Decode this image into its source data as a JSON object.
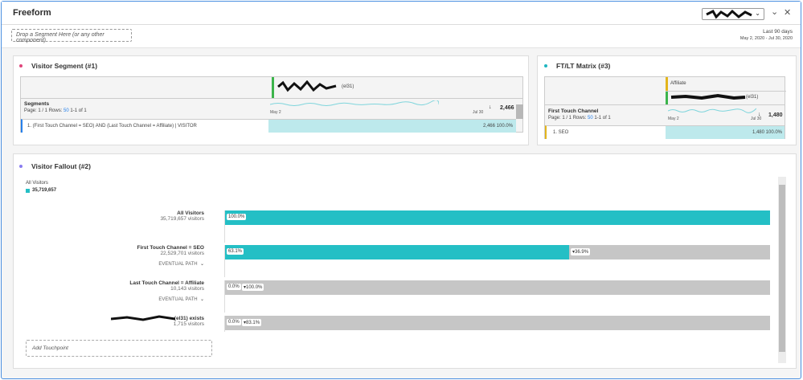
{
  "header": {
    "title": "Freeform",
    "dropdown_value": "[redacted]",
    "date_label": "Last 90 days",
    "date_range": "May 2, 2020 - Jul 30, 2020"
  },
  "drop_segment": {
    "placeholder": "Drop a Segment Here (or any other component)"
  },
  "panel1": {
    "title": "Visitor Segment (#1)",
    "column_header": "(el31)",
    "dimension": "Segments",
    "page_label": "Page: 1 / 1 Rows:",
    "rows_value": "50",
    "range": "1-1 of 1",
    "spark_start": "May 2",
    "spark_end": "Jul 30",
    "total": "2,466",
    "rows": [
      {
        "label": "1. (First Touch Channel = SEO) AND (Last Touch Channel = Affiliate) | VISITOR",
        "value": "2,466",
        "pct": "100.0%"
      }
    ],
    "dot_color": "#e0457b"
  },
  "panel3": {
    "title": "FT/LT Matrix (#3)",
    "column_header_1": "Affiliate",
    "column_header_2": "(el31)",
    "dimension": "First Touch Channel",
    "page_label": "Page: 1 / 1 Rows:",
    "rows_value": "50",
    "range": "1-1 of 1",
    "spark_start": "May 2",
    "spark_end": "Jul 30",
    "total": "1,480",
    "rows": [
      {
        "label": "1. SEO",
        "value": "1,480",
        "pct": "100.0%"
      }
    ],
    "dot_color": "#1fb6c1"
  },
  "panel2": {
    "title": "Visitor Fallout (#2)",
    "legend_label": "All Visitors",
    "legend_value": "35,719,657",
    "dot_color": "#8a7cf0",
    "steps": [
      {
        "name": "All Visitors",
        "visitors": "35,719,657 visitors",
        "pct": "100.0%",
        "fill": 1.0,
        "drop": ""
      },
      {
        "name": "First Touch Channel = SEO",
        "visitors": "22,529,701 visitors",
        "pct": "63.1%",
        "fill": 0.631,
        "drop": "▾36.9%",
        "eventual": "EVENTUAL PATH"
      },
      {
        "name": "Last Touch Channel = Affiliate",
        "visitors": "10,143 visitors",
        "pct": "0.0%",
        "fill": 0.0,
        "drop": "▾100.0%",
        "eventual": "EVENTUAL PATH"
      },
      {
        "name": "(el31) exists",
        "visitors": "1,715 visitors",
        "pct": "0.0%",
        "fill": 0.0,
        "drop": "▾83.1%"
      }
    ],
    "add_touchpoint": "Add Touchpoint"
  }
}
